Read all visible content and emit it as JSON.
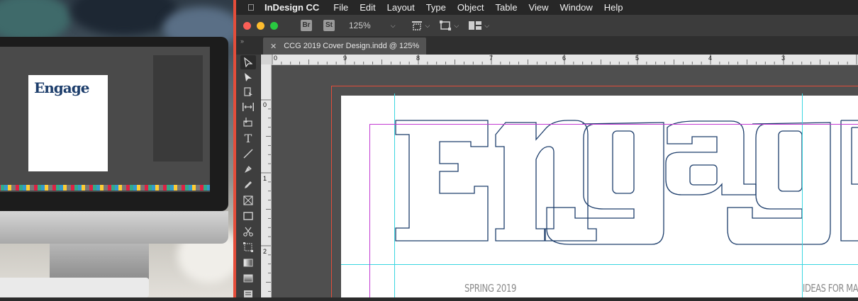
{
  "menubar": {
    "app_name": "InDesign CC",
    "items": [
      "File",
      "Edit",
      "Layout",
      "Type",
      "Object",
      "Table",
      "View",
      "Window",
      "Help"
    ]
  },
  "appbar": {
    "bridge_badge": "Br",
    "stock_badge": "St",
    "zoom": "125%"
  },
  "document_tab": {
    "title": "CCG 2019 Cover Design.indd @ 125%"
  },
  "rulers": {
    "top_labels": [
      "0",
      "9",
      "8",
      "7",
      "6",
      "5",
      "4",
      "3"
    ],
    "left_labels": [
      "0",
      "1",
      "2"
    ]
  },
  "cover": {
    "logo_text": "Engage",
    "left_caption": "SPRING 2019",
    "right_caption": "IDEAS FOR MARKETING AND CREA"
  },
  "colors": {
    "accent_red": "#e44d3a",
    "guide_cyan": "#3ad6e0",
    "margin_magenta": "#c23ad2",
    "logo_navy": "#1c3d6b"
  },
  "tools": [
    "selection-icon",
    "direct-selection-icon",
    "page-tool-icon",
    "gap-tool-icon",
    "content-collector-icon",
    "type-tool-icon",
    "line-tool-icon",
    "pen-tool-icon",
    "pencil-tool-icon",
    "rectangle-frame-icon",
    "rectangle-tool-icon",
    "scissors-icon",
    "free-transform-icon",
    "gradient-swatch-icon",
    "gradient-feather-icon",
    "note-tool-icon"
  ]
}
